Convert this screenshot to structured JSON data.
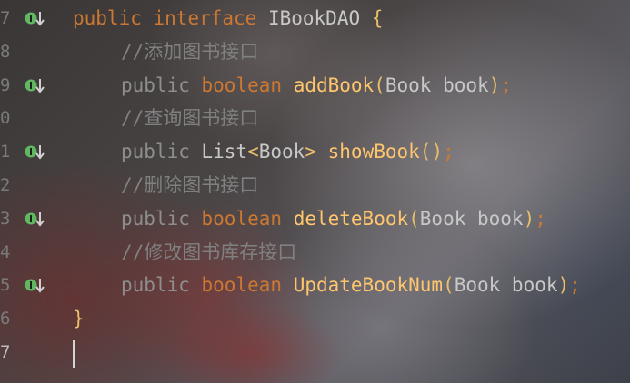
{
  "editor": {
    "lines": [
      {
        "number": "7",
        "has_icon": true,
        "indent": 0,
        "tokens": [
          {
            "text": "public",
            "kind": "kw"
          },
          {
            "text": " ",
            "kind": "ty"
          },
          {
            "text": "interface",
            "kind": "kw"
          },
          {
            "text": " ",
            "kind": "ty"
          },
          {
            "text": "IBookDAO",
            "kind": "ty-light"
          },
          {
            "text": " ",
            "kind": "ty"
          },
          {
            "text": "{",
            "kind": "br"
          }
        ]
      },
      {
        "number": "8",
        "has_icon": false,
        "indent": 1,
        "tokens": [
          {
            "text": "//添加图书接口",
            "kind": "cm"
          }
        ]
      },
      {
        "number": "9",
        "has_icon": true,
        "indent": 1,
        "tokens": [
          {
            "text": "public",
            "kind": "kw-dim"
          },
          {
            "text": " ",
            "kind": "ty"
          },
          {
            "text": "boolean",
            "kind": "kw"
          },
          {
            "text": " ",
            "kind": "ty"
          },
          {
            "text": "addBook",
            "kind": "fn"
          },
          {
            "text": "(",
            "kind": "br"
          },
          {
            "text": "Book book",
            "kind": "ty-light"
          },
          {
            "text": ")",
            "kind": "br"
          },
          {
            "text": ";",
            "kind": "pn"
          }
        ]
      },
      {
        "number": "0",
        "has_icon": false,
        "indent": 1,
        "tokens": [
          {
            "text": "//查询图书接口",
            "kind": "cm"
          }
        ]
      },
      {
        "number": "1",
        "has_icon": true,
        "indent": 1,
        "tokens": [
          {
            "text": "public",
            "kind": "kw-dim"
          },
          {
            "text": " ",
            "kind": "ty"
          },
          {
            "text": "List",
            "kind": "ty-light"
          },
          {
            "text": "<",
            "kind": "br"
          },
          {
            "text": "Book",
            "kind": "ty-light"
          },
          {
            "text": ">",
            "kind": "br"
          },
          {
            "text": " ",
            "kind": "ty"
          },
          {
            "text": "showBook",
            "kind": "fn"
          },
          {
            "text": "()",
            "kind": "br"
          },
          {
            "text": ";",
            "kind": "pn"
          }
        ]
      },
      {
        "number": "2",
        "has_icon": false,
        "indent": 1,
        "tokens": [
          {
            "text": "//删除图书接口",
            "kind": "cm"
          }
        ]
      },
      {
        "number": "3",
        "has_icon": true,
        "indent": 1,
        "tokens": [
          {
            "text": "public",
            "kind": "kw-dim"
          },
          {
            "text": " ",
            "kind": "ty"
          },
          {
            "text": "boolean",
            "kind": "kw"
          },
          {
            "text": " ",
            "kind": "ty"
          },
          {
            "text": "deleteBook",
            "kind": "fn"
          },
          {
            "text": "(",
            "kind": "br"
          },
          {
            "text": "Book book",
            "kind": "ty-light"
          },
          {
            "text": ")",
            "kind": "br"
          },
          {
            "text": ";",
            "kind": "pn"
          }
        ]
      },
      {
        "number": "4",
        "has_icon": false,
        "indent": 1,
        "tokens": [
          {
            "text": "//修改图书库存接口",
            "kind": "cm"
          }
        ]
      },
      {
        "number": "5",
        "has_icon": true,
        "indent": 1,
        "tokens": [
          {
            "text": "public",
            "kind": "kw-dim"
          },
          {
            "text": " ",
            "kind": "ty"
          },
          {
            "text": "boolean",
            "kind": "kw"
          },
          {
            "text": " ",
            "kind": "ty"
          },
          {
            "text": "UpdateBookNum",
            "kind": "fn"
          },
          {
            "text": "(",
            "kind": "br"
          },
          {
            "text": "Book book",
            "kind": "ty-light"
          },
          {
            "text": ")",
            "kind": "br"
          },
          {
            "text": ";",
            "kind": "pn"
          }
        ]
      },
      {
        "number": "6",
        "has_icon": false,
        "indent": 0,
        "tokens": [
          {
            "text": "}",
            "kind": "br"
          }
        ]
      },
      {
        "number": "7",
        "has_icon": false,
        "indent": 0,
        "current": true,
        "tokens": []
      }
    ],
    "gutter_icon": "implemented-interface-arrow-down-icon",
    "colors": {
      "keyword": "#cc7832",
      "function": "#ffc66d",
      "comment": "#808080",
      "type": "#c8c8c8",
      "bracket": "#e8bf6a",
      "gutter_icon": "#5fb760"
    }
  }
}
